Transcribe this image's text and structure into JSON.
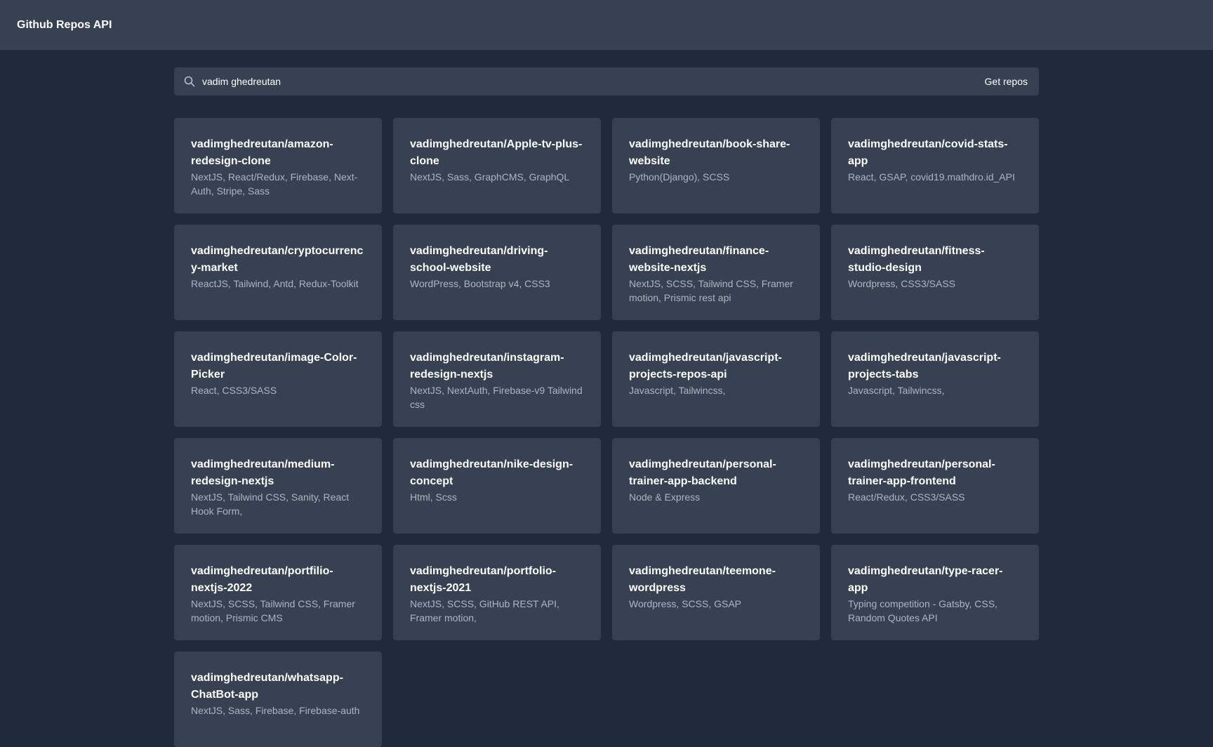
{
  "header": {
    "title": "Github Repos API"
  },
  "search": {
    "value": "vadim ghedreutan",
    "button_label": "Get repos"
  },
  "colors": {
    "background": "#212a3b",
    "surface": "#374152",
    "text": "#ffffff",
    "muted_text": "#aeb5c1"
  },
  "repos": [
    {
      "name": "vadimghedreutan/amazon-redesign-clone",
      "description": "NextJS, React/Redux, Firebase, Next-Auth, Stripe, Sass"
    },
    {
      "name": "vadimghedreutan/Apple-tv-plus-clone",
      "description": "NextJS, Sass, GraphCMS, GraphQL"
    },
    {
      "name": "vadimghedreutan/book-share-website",
      "description": "Python(Django), SCSS"
    },
    {
      "name": "vadimghedreutan/covid-stats-app",
      "description": "React, GSAP, covid19.mathdro.id_API"
    },
    {
      "name": "vadimghedreutan/cryptocurrency-market",
      "description": "ReactJS, Tailwind, Antd, Redux-Toolkit"
    },
    {
      "name": "vadimghedreutan/driving-school-website",
      "description": "WordPress, Bootstrap v4, CSS3"
    },
    {
      "name": "vadimghedreutan/finance-website-nextjs",
      "description": "NextJS, SCSS, Tailwind CSS, Framer motion, Prismic rest api"
    },
    {
      "name": "vadimghedreutan/fitness-studio-design",
      "description": "Wordpress, CSS3/SASS"
    },
    {
      "name": "vadimghedreutan/image-Color-Picker",
      "description": "React, CSS3/SASS"
    },
    {
      "name": "vadimghedreutan/instagram-redesign-nextjs",
      "description": "NextJS, NextAuth, Firebase-v9 Tailwind css"
    },
    {
      "name": "vadimghedreutan/javascript-projects-repos-api",
      "description": "Javascript, Tailwincss,"
    },
    {
      "name": "vadimghedreutan/javascript-projects-tabs",
      "description": "Javascript, Tailwincss,"
    },
    {
      "name": "vadimghedreutan/medium-redesign-nextjs",
      "description": "NextJS, Tailwind CSS, Sanity, React Hook Form,"
    },
    {
      "name": "vadimghedreutan/nike-design-concept",
      "description": "Html, Scss"
    },
    {
      "name": "vadimghedreutan/personal-trainer-app-backend",
      "description": "Node & Express"
    },
    {
      "name": "vadimghedreutan/personal-trainer-app-frontend",
      "description": "React/Redux, CSS3/SASS"
    },
    {
      "name": "vadimghedreutan/portfilio-nextjs-2022",
      "description": "NextJS, SCSS, Tailwind CSS, Framer motion, Prismic CMS"
    },
    {
      "name": "vadimghedreutan/portfolio-nextjs-2021",
      "description": "NextJS, SCSS, GitHub REST API, Framer motion,"
    },
    {
      "name": "vadimghedreutan/teemone-wordpress",
      "description": "Wordpress, SCSS, GSAP"
    },
    {
      "name": "vadimghedreutan/type-racer-app",
      "description": "Typing competition - Gatsby, CSS, Random Quotes API"
    },
    {
      "name": "vadimghedreutan/whatsapp-ChatBot-app",
      "description": "NextJS, Sass, Firebase, Firebase-auth"
    }
  ]
}
